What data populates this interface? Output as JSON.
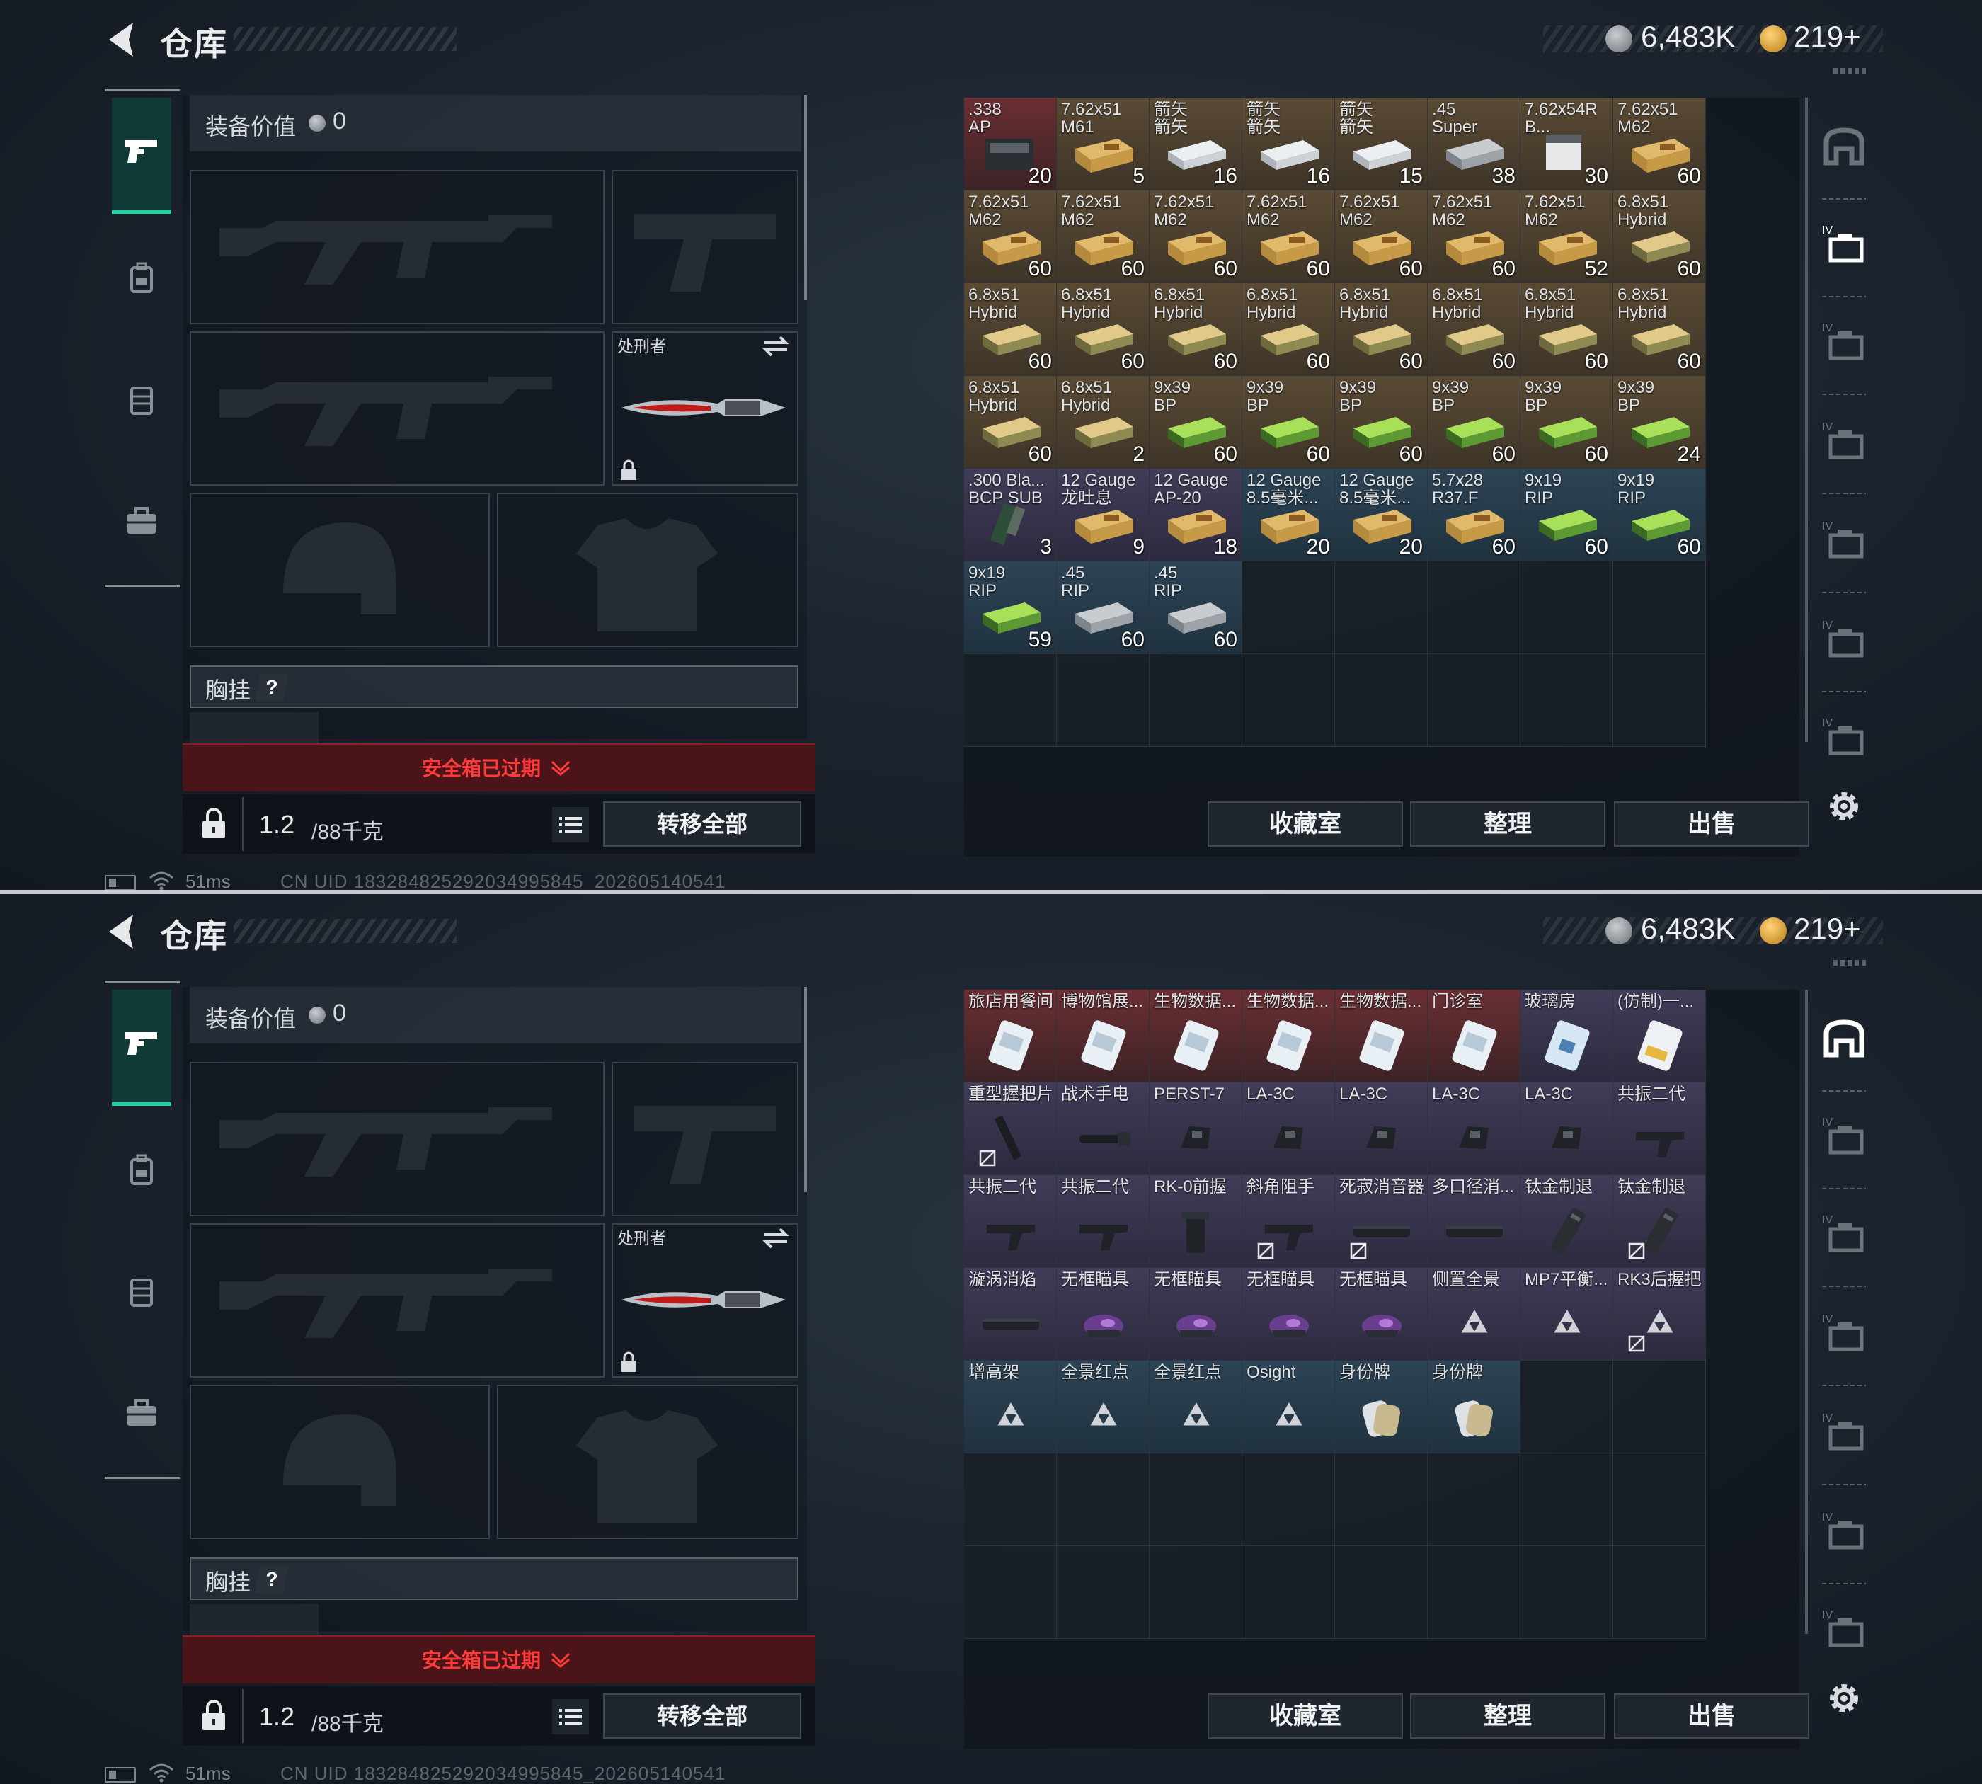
{
  "header": {
    "title": "仓库",
    "currency1": "6,483K",
    "currency2": "219+"
  },
  "loadout": {
    "equip_value_label": "装备价值",
    "equip_value": "0",
    "knife_label": "处刑者",
    "chest_label": "胸挂",
    "chest_hint": "?",
    "warning": "安全箱已过期",
    "weight_value": "1.2",
    "weight_max": "/88千克",
    "transfer_all": "转移全部"
  },
  "status": {
    "ping": "51ms",
    "uid": "CN UID 1832848252920349958​45_202605140541"
  },
  "stash_buttons": {
    "collection": "收藏室",
    "organize": "整理",
    "sell": "出售"
  },
  "colors": {
    "accent": "#19d3a5",
    "warning": "#ff3a3a",
    "legendary": "#6a2f33",
    "gold": "#5a4a34",
    "epic": "#413c58",
    "rare": "#2d4456"
  },
  "screens": [
    {
      "active_tab": 1,
      "items": [
        {
          "l1": ".338",
          "l2": "AP",
          "count": "20",
          "tier": "red",
          "art": "ammo-black"
        },
        {
          "l1": "7.62x51",
          "l2": "M61",
          "count": "5",
          "tier": "gold",
          "art": "ammo-tan"
        },
        {
          "l1": "箭矢",
          "l2": "箭矢",
          "count": "16",
          "tier": "gold",
          "art": "case-white"
        },
        {
          "l1": "箭矢",
          "l2": "箭矢",
          "count": "16",
          "tier": "gold",
          "art": "case-white"
        },
        {
          "l1": "箭矢",
          "l2": "箭矢",
          "count": "15",
          "tier": "gold",
          "art": "case-white"
        },
        {
          "l1": ".45",
          "l2": "Super",
          "count": "38",
          "tier": "gold",
          "art": "ammo-grey"
        },
        {
          "l1": "7.62x54R",
          "l2": "B...",
          "count": "30",
          "tier": "gold",
          "art": "ammo-white"
        },
        {
          "l1": "7.62x51",
          "l2": "M62",
          "count": "60",
          "tier": "gold",
          "art": "ammo-tan"
        },
        {
          "l1": "7.62x51",
          "l2": "M62",
          "count": "60",
          "tier": "gold",
          "art": "ammo-tan"
        },
        {
          "l1": "7.62x51",
          "l2": "M62",
          "count": "60",
          "tier": "gold",
          "art": "ammo-tan"
        },
        {
          "l1": "7.62x51",
          "l2": "M62",
          "count": "60",
          "tier": "gold",
          "art": "ammo-tan"
        },
        {
          "l1": "7.62x51",
          "l2": "M62",
          "count": "60",
          "tier": "gold",
          "art": "ammo-tan"
        },
        {
          "l1": "7.62x51",
          "l2": "M62",
          "count": "60",
          "tier": "gold",
          "art": "ammo-tan"
        },
        {
          "l1": "7.62x51",
          "l2": "M62",
          "count": "60",
          "tier": "gold",
          "art": "ammo-tan"
        },
        {
          "l1": "7.62x51",
          "l2": "M62",
          "count": "52",
          "tier": "gold",
          "art": "ammo-tan"
        },
        {
          "l1": "6.8x51",
          "l2": "Hybrid",
          "count": "60",
          "tier": "gold",
          "art": "ammo-olive"
        },
        {
          "l1": "6.8x51",
          "l2": "Hybrid",
          "count": "60",
          "tier": "gold",
          "art": "ammo-olive"
        },
        {
          "l1": "6.8x51",
          "l2": "Hybrid",
          "count": "60",
          "tier": "gold",
          "art": "ammo-olive"
        },
        {
          "l1": "6.8x51",
          "l2": "Hybrid",
          "count": "60",
          "tier": "gold",
          "art": "ammo-olive"
        },
        {
          "l1": "6.8x51",
          "l2": "Hybrid",
          "count": "60",
          "tier": "gold",
          "art": "ammo-olive"
        },
        {
          "l1": "6.8x51",
          "l2": "Hybrid",
          "count": "60",
          "tier": "gold",
          "art": "ammo-olive"
        },
        {
          "l1": "6.8x51",
          "l2": "Hybrid",
          "count": "60",
          "tier": "gold",
          "art": "ammo-olive"
        },
        {
          "l1": "6.8x51",
          "l2": "Hybrid",
          "count": "60",
          "tier": "gold",
          "art": "ammo-olive"
        },
        {
          "l1": "6.8x51",
          "l2": "Hybrid",
          "count": "60",
          "tier": "gold",
          "art": "ammo-olive"
        },
        {
          "l1": "6.8x51",
          "l2": "Hybrid",
          "count": "60",
          "tier": "gold",
          "art": "ammo-olive"
        },
        {
          "l1": "6.8x51",
          "l2": "Hybrid",
          "count": "2",
          "tier": "gold",
          "art": "ammo-olive"
        },
        {
          "l1": "9x39",
          "l2": "BP",
          "count": "60",
          "tier": "gold",
          "art": "ammo-green"
        },
        {
          "l1": "9x39",
          "l2": "BP",
          "count": "60",
          "tier": "gold",
          "art": "ammo-green"
        },
        {
          "l1": "9x39",
          "l2": "BP",
          "count": "60",
          "tier": "gold",
          "art": "ammo-green"
        },
        {
          "l1": "9x39",
          "l2": "BP",
          "count": "60",
          "tier": "gold",
          "art": "ammo-green"
        },
        {
          "l1": "9x39",
          "l2": "BP",
          "count": "60",
          "tier": "gold",
          "art": "ammo-green"
        },
        {
          "l1": "9x39",
          "l2": "BP",
          "count": "24",
          "tier": "gold",
          "art": "ammo-green"
        },
        {
          "l1": ".300 Bla...",
          "l2": "BCP SUB",
          "count": "3",
          "tier": "purple",
          "art": "mag-green"
        },
        {
          "l1": "12 Gauge",
          "l2": "龙吐息",
          "count": "9",
          "tier": "purple",
          "art": "ammo-tan"
        },
        {
          "l1": "12 Gauge",
          "l2": "AP-20",
          "count": "18",
          "tier": "purple",
          "art": "ammo-tan"
        },
        {
          "l1": "12 Gauge",
          "l2": "8.5毫米...",
          "count": "20",
          "tier": "blue",
          "art": "ammo-tan"
        },
        {
          "l1": "12 Gauge",
          "l2": "8.5毫米...",
          "count": "20",
          "tier": "blue",
          "art": "ammo-tan"
        },
        {
          "l1": "5.7x28",
          "l2": "R37.F",
          "count": "60",
          "tier": "blue",
          "art": "ammo-tan"
        },
        {
          "l1": "9x19",
          "l2": "RIP",
          "count": "60",
          "tier": "blue",
          "art": "ammo-green"
        },
        {
          "l1": "9x19",
          "l2": "RIP",
          "count": "60",
          "tier": "blue",
          "art": "ammo-green"
        },
        {
          "l1": "9x19",
          "l2": "RIP",
          "count": "59",
          "tier": "blue",
          "art": "ammo-green"
        },
        {
          "l1": ".45",
          "l2": "RIP",
          "count": "60",
          "tier": "blue",
          "art": "ammo-grey"
        },
        {
          "l1": ".45",
          "l2": "RIP",
          "count": "60",
          "tier": "blue",
          "art": "ammo-grey"
        }
      ]
    },
    {
      "active_tab": 0,
      "items": [
        {
          "l1": "旅店用餐间",
          "l2": "",
          "count": "",
          "tier": "red",
          "art": "keycard"
        },
        {
          "l1": "博物馆展...",
          "l2": "",
          "count": "",
          "tier": "red",
          "art": "keycard"
        },
        {
          "l1": "生物数据...",
          "l2": "",
          "count": "",
          "tier": "red",
          "art": "keycard"
        },
        {
          "l1": "生物数据...",
          "l2": "",
          "count": "",
          "tier": "red",
          "art": "keycard"
        },
        {
          "l1": "生物数据...",
          "l2": "",
          "count": "",
          "tier": "red",
          "art": "keycard"
        },
        {
          "l1": "门诊室",
          "l2": "",
          "count": "",
          "tier": "red",
          "art": "keycard"
        },
        {
          "l1": "玻璃房",
          "l2": "",
          "count": "",
          "tier": "purple",
          "art": "keycard-blue"
        },
        {
          "l1": "(仿制)一...",
          "l2": "",
          "count": "",
          "tier": "purple",
          "art": "keycard-gold"
        },
        {
          "l1": "重型握把片",
          "l2": "",
          "count": "",
          "tier": "purple",
          "art": "rail",
          "nosell": true
        },
        {
          "l1": "战术手电",
          "l2": "",
          "count": "",
          "tier": "purple",
          "art": "flashlight"
        },
        {
          "l1": "PERST-7",
          "l2": "",
          "count": "",
          "tier": "purple",
          "art": "laser"
        },
        {
          "l1": "LA-3C",
          "l2": "",
          "count": "",
          "tier": "purple",
          "art": "laser"
        },
        {
          "l1": "LA-3C",
          "l2": "",
          "count": "",
          "tier": "purple",
          "art": "laser"
        },
        {
          "l1": "LA-3C",
          "l2": "",
          "count": "",
          "tier": "purple",
          "art": "laser"
        },
        {
          "l1": "LA-3C",
          "l2": "",
          "count": "",
          "tier": "purple",
          "art": "laser"
        },
        {
          "l1": "共振二代",
          "l2": "",
          "count": "",
          "tier": "purple",
          "art": "grip"
        },
        {
          "l1": "共振二代",
          "l2": "",
          "count": "",
          "tier": "purple",
          "art": "grip"
        },
        {
          "l1": "共振二代",
          "l2": "",
          "count": "",
          "tier": "purple",
          "art": "grip"
        },
        {
          "l1": "RK-0前握",
          "l2": "",
          "count": "",
          "tier": "purple",
          "art": "vgrip"
        },
        {
          "l1": "斜角阻手",
          "l2": "",
          "count": "",
          "tier": "purple",
          "art": "grip",
          "nosell": true
        },
        {
          "l1": "死寂消音器",
          "l2": "",
          "count": "",
          "tier": "purple",
          "art": "suppressor",
          "nosell": true
        },
        {
          "l1": "多口径消...",
          "l2": "",
          "count": "",
          "tier": "purple",
          "art": "suppressor"
        },
        {
          "l1": "钛金制退",
          "l2": "",
          "count": "",
          "tier": "purple",
          "art": "brake"
        },
        {
          "l1": "钛金制退",
          "l2": "",
          "count": "",
          "tier": "purple",
          "art": "brake",
          "nosell": true
        },
        {
          "l1": "漩涡消焰",
          "l2": "",
          "count": "",
          "tier": "purple",
          "art": "suppressor"
        },
        {
          "l1": "无框瞄具",
          "l2": "",
          "count": "",
          "tier": "purple",
          "art": "sight"
        },
        {
          "l1": "无框瞄具",
          "l2": "",
          "count": "",
          "tier": "purple",
          "art": "sight"
        },
        {
          "l1": "无框瞄具",
          "l2": "",
          "count": "",
          "tier": "purple",
          "art": "sight"
        },
        {
          "l1": "无框瞄具",
          "l2": "",
          "count": "",
          "tier": "purple",
          "art": "sight"
        },
        {
          "l1": "侧置全景",
          "l2": "",
          "count": "",
          "tier": "purple",
          "art": "tri"
        },
        {
          "l1": "MP7平衡...",
          "l2": "",
          "count": "",
          "tier": "purple",
          "art": "tri"
        },
        {
          "l1": "RK3后握把",
          "l2": "",
          "count": "",
          "tier": "purple",
          "art": "tri",
          "nosell": true
        },
        {
          "l1": "增高架",
          "l2": "",
          "count": "",
          "tier": "blue",
          "art": "tri"
        },
        {
          "l1": "全景红点",
          "l2": "",
          "count": "",
          "tier": "blue",
          "art": "tri"
        },
        {
          "l1": "全景红点",
          "l2": "",
          "count": "",
          "tier": "blue",
          "art": "tri"
        },
        {
          "l1": "Osight",
          "l2": "",
          "count": "",
          "tier": "blue",
          "art": "tri"
        },
        {
          "l1": "身份牌",
          "l2": "",
          "count": "",
          "tier": "blue",
          "art": "dogtag"
        },
        {
          "l1": "身份牌",
          "l2": "",
          "count": "",
          "tier": "blue",
          "art": "dogtag"
        }
      ]
    }
  ]
}
